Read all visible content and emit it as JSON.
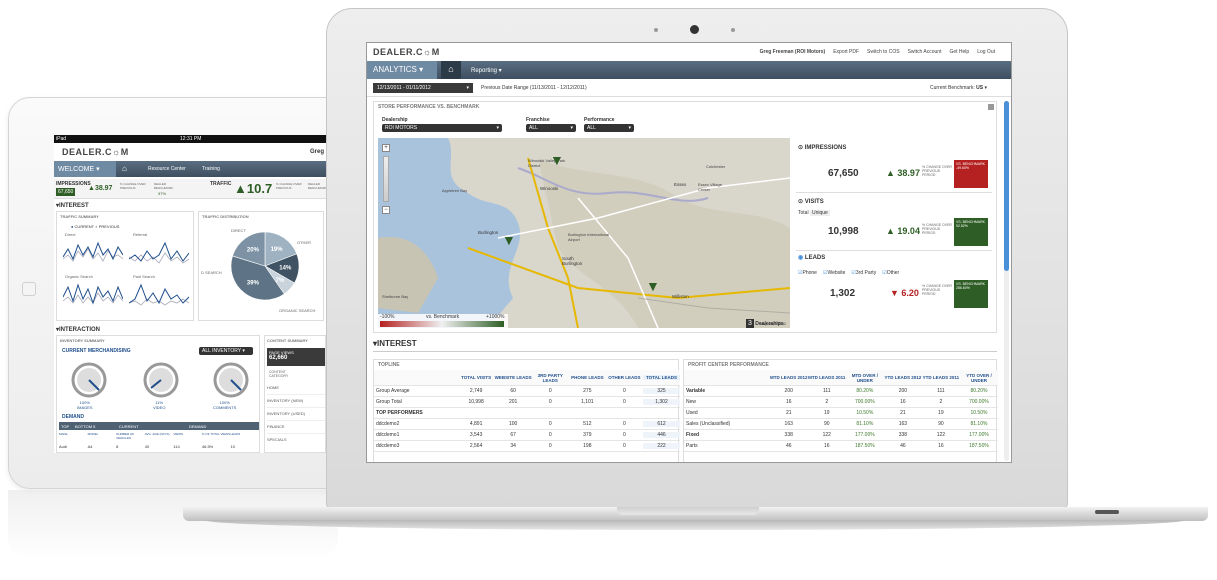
{
  "tablet": {
    "status": {
      "left": "iPad",
      "time": "12:31 PM"
    },
    "brand": "DEALER.C☼M",
    "user": "Greg",
    "nav": {
      "welcome": "WELCOME",
      "resource": "Resource Center",
      "training": "Training"
    },
    "kpis": [
      {
        "label": "IMPRESSIONS",
        "value": "67,650",
        "change": "38.97",
        "note": "% CHANGE OVER PREVIOUS",
        "bench": "DEALER BENCHMARK",
        "bench_val": "97%"
      },
      {
        "label": "TRAFFIC",
        "value": "10.7",
        "note": "% CHANGE OVER PREVIOUS",
        "bench": "DEALER BENCHMARK"
      }
    ],
    "interest_title": "▾INTEREST",
    "traffic_summary": {
      "title": "TRAFFIC SUMMARY",
      "legend_current": "CURRENT",
      "legend_previous": "PREVIOUS",
      "panels": [
        "Direct",
        "Referral",
        "Organic Search",
        "Paid Search"
      ]
    },
    "traffic_distribution": {
      "title": "TRAFFIC DISTRIBUTION",
      "labels": [
        "DIRECT",
        "OTHER",
        "D SEARCH",
        "ORGANIC SEARCH"
      ],
      "slices": [
        {
          "label": "19%",
          "value": 19
        },
        {
          "label": "14%",
          "value": 14
        },
        {
          "label": "7%",
          "value": 7
        },
        {
          "label": "39%",
          "value": 39
        },
        {
          "label": "20%",
          "value": 20
        }
      ]
    },
    "interaction_title": "▾INTERACTION",
    "inventory_summary": {
      "title": "INVENTORY SUMMARY",
      "current": "CURRENT MERCHANDISING",
      "select": "ALL INVENTORY",
      "gauges": [
        {
          "pct": "100%",
          "label": "IMAGES"
        },
        {
          "pct": "11%",
          "label": "VIDEO"
        },
        {
          "pct": "100%",
          "label": "COMMENTS"
        }
      ]
    },
    "demand": {
      "title": "DEMAND",
      "tabs": [
        "TOP",
        "BOTTOM 5",
        "CURRENT",
        "DEMAND"
      ],
      "headers": [
        "MAKE",
        "MODEL",
        "NUMBER OF VEHICLES",
        "AVG. AGE (DAYS)",
        "VIEWS",
        "% OF TOTAL VIEWS",
        "LEADS"
      ],
      "row": [
        "Audi",
        "A4",
        "8",
        "40",
        "114",
        "46.5%",
        "10"
      ]
    },
    "content_summary": {
      "title": "CONTENT SUMMARY",
      "page_views_label": "PAGE VIEWS",
      "page_views": "62,660",
      "category": "CONTENT CATEGORY",
      "items": [
        "HOME",
        "INVENTORY (NEW)",
        "INVENTORY (USED)",
        "FINANCE",
        "SPECIALS"
      ]
    }
  },
  "laptop": {
    "brand": "DEALER.C☼M",
    "top_links": [
      "Greg Freeman (ROI Motors)",
      "Export PDF",
      "Switch to COS",
      "Switch Account",
      "Get Help",
      "Log Out"
    ],
    "nav": {
      "analytics": "ANALYTICS",
      "reporting": "Reporting"
    },
    "date_range": "12/13/2011 - 01/11/2012",
    "prev_range": "Previous Date Range (11/13/2011 - 12/12/2011)",
    "benchmark_label": "Current Benchmark:",
    "benchmark_value": "US",
    "store_perf_title": "STORE PERFORMANCE VS. BENCHMARK",
    "filters": [
      {
        "label": "Dealership",
        "value": "ROI MOTORS"
      },
      {
        "label": "Franchise",
        "value": "ALL"
      },
      {
        "label": "Performance",
        "value": "ALL"
      }
    ],
    "map": {
      "places": [
        "Winooski Valley Park District",
        "Winooski",
        "Essex",
        "Essex Village Center",
        "Colchester",
        "Burlington",
        "Burlington International Airport",
        "South Burlington",
        "Williston",
        "Shelburne Bay",
        "Appletree Bay"
      ],
      "scale_min": "-100%",
      "scale_mid": "vs. Benchmark",
      "scale_max": "+1000%",
      "dealership_count": "3",
      "dealership_label": "Dealerships",
      "credit": "Map data ©2012"
    },
    "metrics": [
      {
        "title": "IMPRESSIONS",
        "value": "67,650",
        "dir": "up",
        "change": "38.97",
        "note": "% CHANGE OVER PREVIOUS PERIOD",
        "bench_label": "VS. BENCHMARK",
        "bench_val": "-49.60%",
        "bench_color": "#b52020"
      },
      {
        "title": "VISITS",
        "tabs": [
          "Total",
          "Unique"
        ],
        "value": "10,998",
        "dir": "up",
        "change": "19.04",
        "note": "% CHANGE OVER PREVIOUS PERIOD",
        "bench_label": "VS. BENCHMARK",
        "bench_val": "92.52%",
        "bench_color": "#2e5e25"
      },
      {
        "title": "LEADS",
        "checks": [
          "Phone",
          "Website",
          "3rd Party",
          "Other"
        ],
        "value": "1,302",
        "dir": "down",
        "change": "6.20",
        "note": "% CHANGE OVER PREVIOUS PERIOD",
        "bench_label": "VS. BENCHMARK",
        "bench_val": "286.60%",
        "bench_color": "#2e5e25"
      }
    ],
    "interest_title": "▾INTEREST",
    "topline": {
      "title": "TOPLINE",
      "headers": [
        "",
        "TOTAL VISITS",
        "WEBSITE LEADS",
        "3RD PARTY LEADS",
        "PHONE LEADS",
        "OTHER LEADS",
        "TOTAL LEADS"
      ],
      "rows": [
        [
          "Group Average",
          "2,749",
          "60",
          "0",
          "275",
          "0",
          "325"
        ],
        [
          "Group Total",
          "10,998",
          "201",
          "0",
          "1,101",
          "0",
          "1,302"
        ],
        [
          "TOP PERFORMERS",
          "",
          "",
          "",
          "",
          "",
          ""
        ],
        [
          "ddcdemo2",
          "4,891",
          "100",
          "0",
          "512",
          "0",
          "612"
        ],
        [
          "ddcdemo1",
          "3,543",
          "67",
          "0",
          "379",
          "0",
          "446"
        ],
        [
          "ddcdemo3",
          "2,564",
          "34",
          "0",
          "198",
          "0",
          "222"
        ]
      ]
    },
    "profit": {
      "title": "PROFIT CENTER PERFORMANCE",
      "headers": [
        "",
        "MTD LEADS 2012",
        "MTD LEADS 2011",
        "MTD OVER / UNDER",
        "YTD LEADS 2012",
        "YTD LEADS 2011",
        "YTD OVER / UNDER"
      ],
      "rows": [
        [
          "Variable",
          "200",
          "111",
          "80.20%",
          "200",
          "111",
          "80.20%"
        ],
        [
          "New",
          "16",
          "2",
          "700.00%",
          "16",
          "2",
          "700.00%"
        ],
        [
          "Used",
          "21",
          "19",
          "10.50%",
          "21",
          "19",
          "10.50%"
        ],
        [
          "Sales (Unclassified)",
          "163",
          "90",
          "81.10%",
          "163",
          "90",
          "81.10%"
        ],
        [
          "Fixed",
          "338",
          "122",
          "177.00%",
          "338",
          "122",
          "177.00%"
        ],
        [
          "Parts",
          "46",
          "16",
          "187.50%",
          "46",
          "16",
          "187.50%"
        ]
      ]
    }
  }
}
